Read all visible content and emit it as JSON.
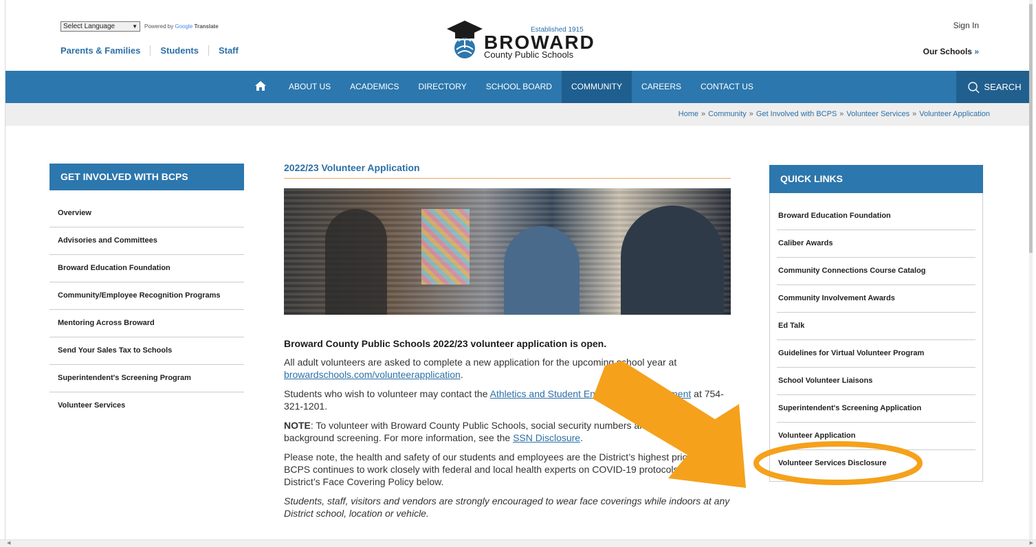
{
  "header": {
    "language_select": "Select Language",
    "powered_by": "Powered by",
    "translate_brand": "Google",
    "translate_label": "Translate",
    "audience_links": [
      "Parents & Families",
      "Students",
      "Staff"
    ],
    "logo": {
      "established": "Established 1915",
      "name": "BROWARD",
      "subtitle": "County Public Schools"
    },
    "sign_in": "Sign In",
    "our_schools": "Our Schools",
    "our_schools_arrow": "»"
  },
  "nav": {
    "items": [
      "ABOUT US",
      "ACADEMICS",
      "DIRECTORY",
      "SCHOOL BOARD",
      "COMMUNITY",
      "CAREERS",
      "CONTACT US"
    ],
    "active": "COMMUNITY",
    "search_label": "SEARCH",
    "home_icon": "home-icon",
    "color": "#2c77ad"
  },
  "breadcrumb": [
    "Home",
    "Community",
    "Get Involved with BCPS",
    "Volunteer Services",
    "Volunteer Application"
  ],
  "breadcrumb_sep": "»",
  "left_sidebar": {
    "title": "GET INVOLVED WITH BCPS",
    "items": [
      "Overview",
      "Advisories and Committees",
      "Broward Education Foundation",
      "Community/Employee Recognition Programs",
      "Mentoring Across Broward",
      "Send Your Sales Tax to Schools",
      "Superintendent's Screening Program",
      "Volunteer Services"
    ]
  },
  "main": {
    "title": "2022/23 Volunteer Application",
    "heading": "Broward County Public Schools 2022/23 volunteer application is open.",
    "p1_text": "All adult volunteers are asked to complete a new application for the upcoming school year at ",
    "p1_link": "browardschools.com/volunteerapplication",
    "p1_end": ".",
    "p2_text": "Students who wish to volunteer may contact the ",
    "p2_link": "Athletics and Student Engagement Department",
    "p2_end": " at 754-321-1201.",
    "p3_bold": "NOTE",
    "p3_text": ": To volunteer with Broward County Public Schools, social security numbers are required for background screening. For more information, see the ",
    "p3_link": "SSN Disclosure",
    "p3_end": ".",
    "p4_text": "Please note, the health and safety of our students and employees are the District’s highest priorities. BCPS continues to work closely with federal and local health experts on COVID-19 protocols. See the District’s Face Covering Policy below.",
    "p5_text": "Students, staff, visitors and vendors are strongly encouraged to wear face coverings while indoors at any District school, location or vehicle."
  },
  "quick_links": {
    "title": "QUICK LINKS",
    "items": [
      "Broward Education Foundation",
      "Caliber Awards",
      "Community Connections Course Catalog",
      "Community Involvement Awards",
      "Ed Talk",
      "Guidelines for Virtual Volunteer Program",
      "School Volunteer Liaisons",
      "Superintendent's Screening Application",
      "Volunteer Application",
      "Volunteer Services Disclosure"
    ]
  },
  "annotation": {
    "arrow_color": "#f5a11c",
    "highlight_color": "#f5a11c",
    "highlighted_item": "Volunteer Services Disclosure"
  }
}
